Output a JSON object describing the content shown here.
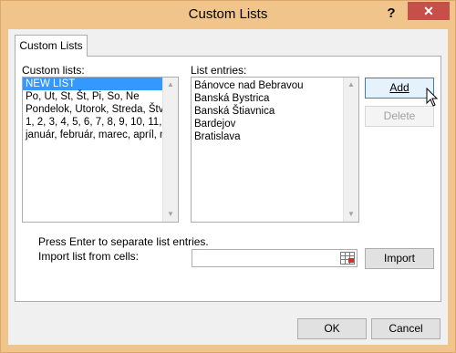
{
  "window": {
    "title": "Custom Lists",
    "help_label": "?",
    "close_label": "✕"
  },
  "tabs": [
    {
      "label": "Custom Lists"
    }
  ],
  "custom_lists": {
    "label": "Custom lists:",
    "items": [
      "NEW LIST",
      "Po, Ut, St, Št, Pi, So, Ne",
      "Pondelok, Utorok, Streda, Štvrtok",
      "1, 2, 3, 4, 5, 6, 7, 8, 9, 10, 11,",
      "január, február, marec, apríl, máj"
    ],
    "selected_index": 0
  },
  "list_entries": {
    "label": "List entries:",
    "items": [
      "Bánovce nad Bebravou",
      "Banská Bystrica",
      "Banská Štiavnica",
      "Bardejov",
      "Bratislava"
    ]
  },
  "buttons": {
    "add": "Add",
    "delete": "Delete",
    "import": "Import",
    "ok": "OK",
    "cancel": "Cancel"
  },
  "hint": "Press Enter to separate list entries.",
  "import_label": "Import list from cells:",
  "import_value": "",
  "colors": {
    "titlebar": "#f0c48a",
    "close_button": "#c74f4a",
    "selection": "#3399ff"
  }
}
